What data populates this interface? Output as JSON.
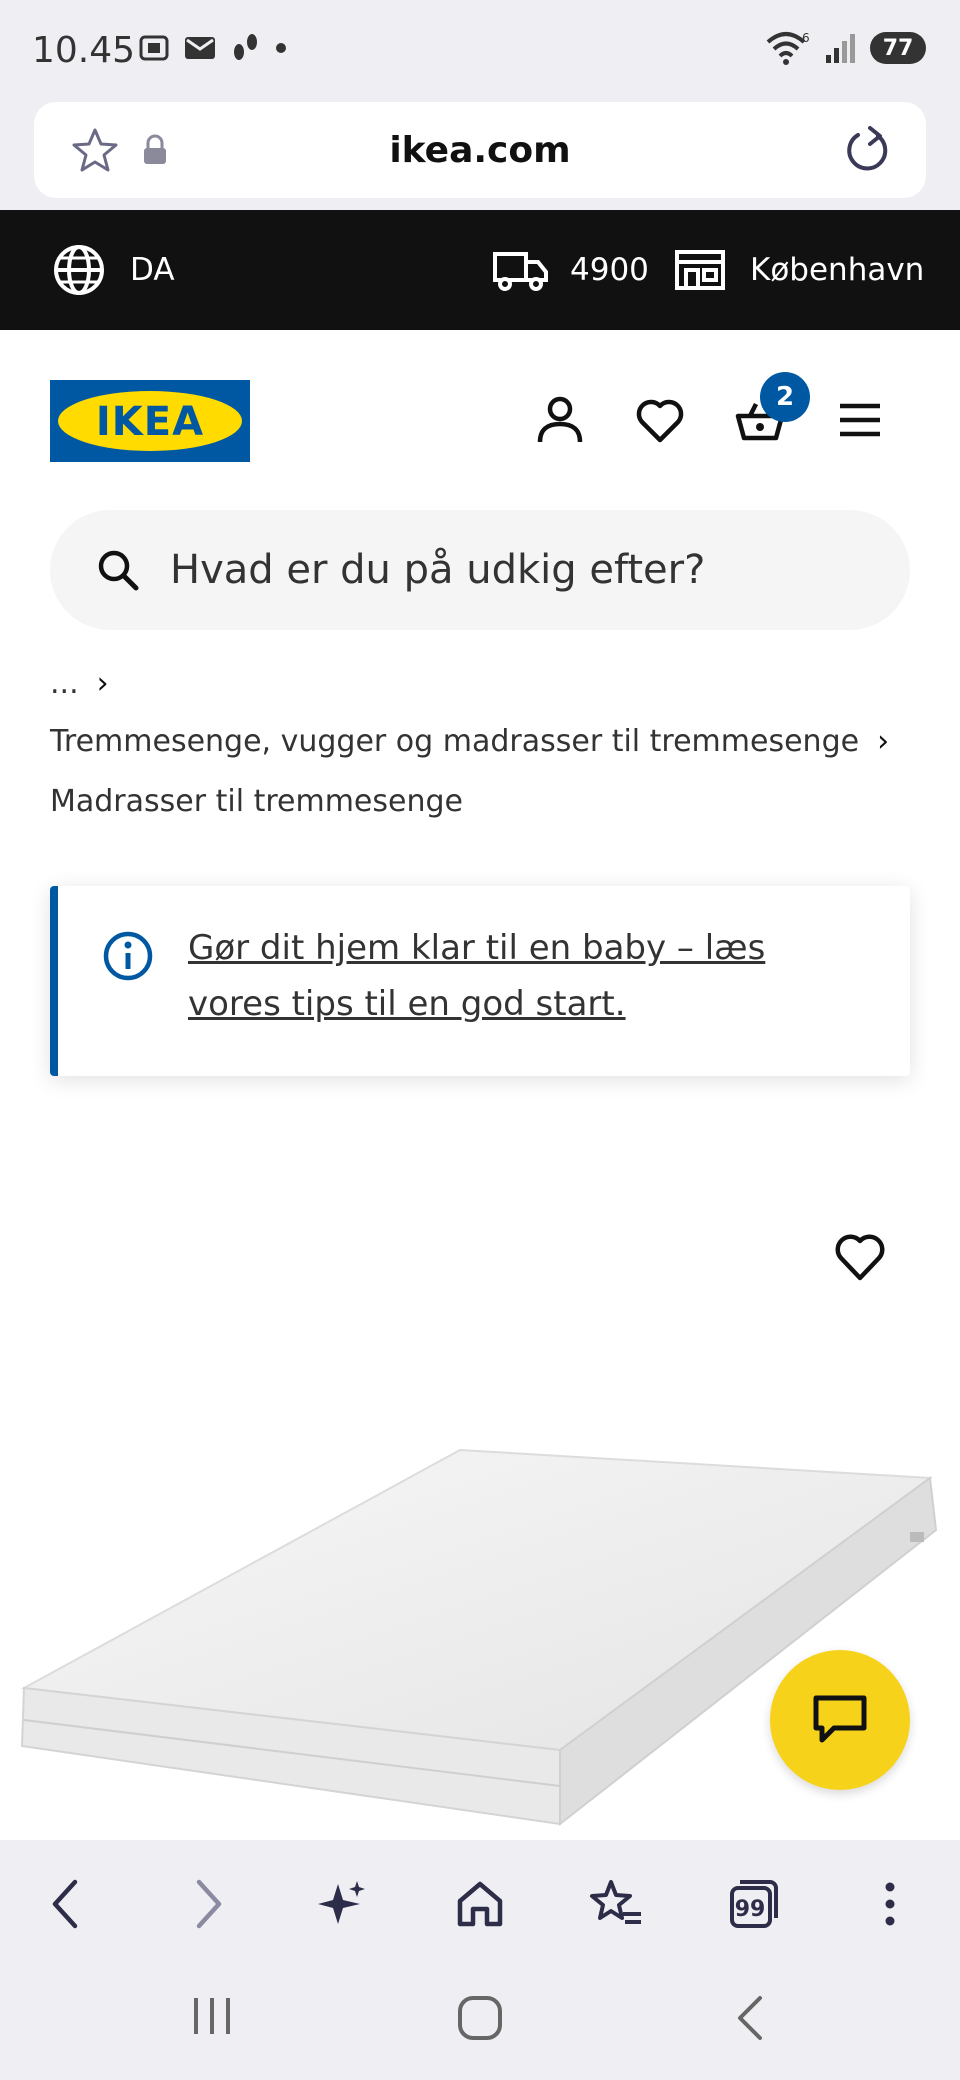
{
  "status_bar": {
    "time": "10.45",
    "battery": "77",
    "wifi_label": "6"
  },
  "browser": {
    "url": "ikea.com"
  },
  "top_bar": {
    "language": "DA",
    "postal_code": "4900",
    "store": "København"
  },
  "header": {
    "logo_text": "IKEA",
    "cart_count": "2"
  },
  "search": {
    "placeholder": "Hvad er du på udkig efter?"
  },
  "breadcrumbs": {
    "ellipsis": "...",
    "category": "Tremmesenge, vugger og madrasser til tremmesenge",
    "current": "Madrasser til tremmesenge"
  },
  "info_box": {
    "link_text": "Gør dit hjem klar til en baby – læs vores tips til en god start."
  },
  "colors": {
    "ikea_blue": "#0058a3",
    "ikea_yellow": "#ffdb00",
    "chat_yellow": "#f7d21b",
    "top_bar_bg": "#111111"
  },
  "browser_toolbar": {
    "tab_count": "99"
  }
}
